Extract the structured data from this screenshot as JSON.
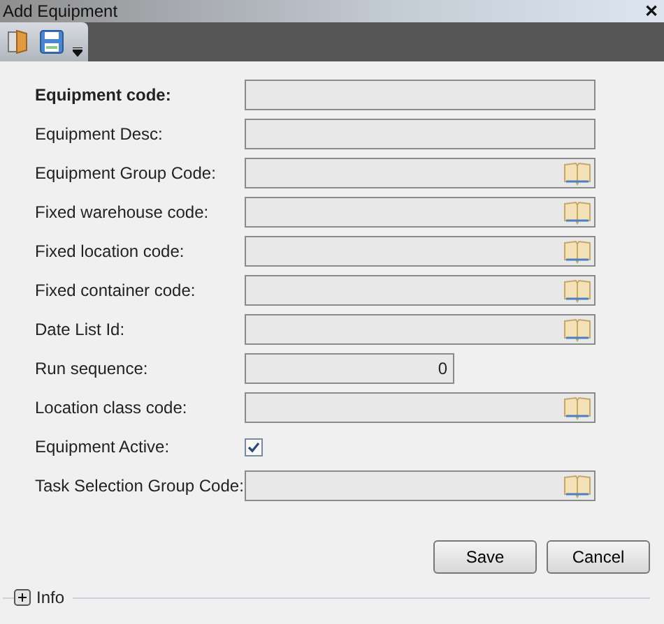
{
  "window": {
    "title": "Add Equipment",
    "close": "✕"
  },
  "fields": [
    {
      "label": "Equipment code:",
      "kind": "text",
      "required": true
    },
    {
      "label": "Equipment Desc:",
      "kind": "text",
      "required": false
    },
    {
      "label": "Equipment Group Code:",
      "kind": "lookup",
      "required": false
    },
    {
      "label": "Fixed warehouse code:",
      "kind": "lookup",
      "required": false
    },
    {
      "label": "Fixed location code:",
      "kind": "lookup",
      "required": false
    },
    {
      "label": "Fixed container code:",
      "kind": "lookup",
      "required": false
    },
    {
      "label": "Date List Id:",
      "kind": "lookup",
      "required": false
    },
    {
      "label": "Run sequence:",
      "kind": "number",
      "required": false,
      "value": "0"
    },
    {
      "label": "Location class code:",
      "kind": "lookup",
      "required": false
    },
    {
      "label": "Equipment Active:",
      "kind": "checkbox",
      "required": false,
      "checked": true
    },
    {
      "label": "Task Selection Group Code:",
      "kind": "lookup",
      "required": false
    }
  ],
  "buttons": [
    "Save",
    "Cancel"
  ],
  "info": {
    "label": "Info",
    "expanded": false
  }
}
